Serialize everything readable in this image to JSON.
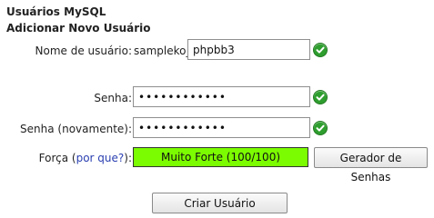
{
  "header": {
    "title": "Usuários MySQL",
    "subtitle": "Adicionar Novo Usuário"
  },
  "form": {
    "username": {
      "label": "Nome de usuário:",
      "prefix": "sampleko_",
      "value": "phpbb3"
    },
    "password": {
      "label": "Senha:",
      "value": "••••••••••••"
    },
    "password_again": {
      "label": "Senha (novamente):",
      "value": "••••••••••••"
    },
    "strength": {
      "label": "Força",
      "open_paren": "(",
      "why_link": "por que?",
      "close": "):",
      "value": "Muito Forte (100/100)",
      "color": "#7cfc00"
    },
    "generator_button": "Gerador de Senhas",
    "submit_button": "Criar Usuário"
  },
  "icons": {
    "valid": "check-circle-icon",
    "valid_color": "#2e9e2e"
  }
}
